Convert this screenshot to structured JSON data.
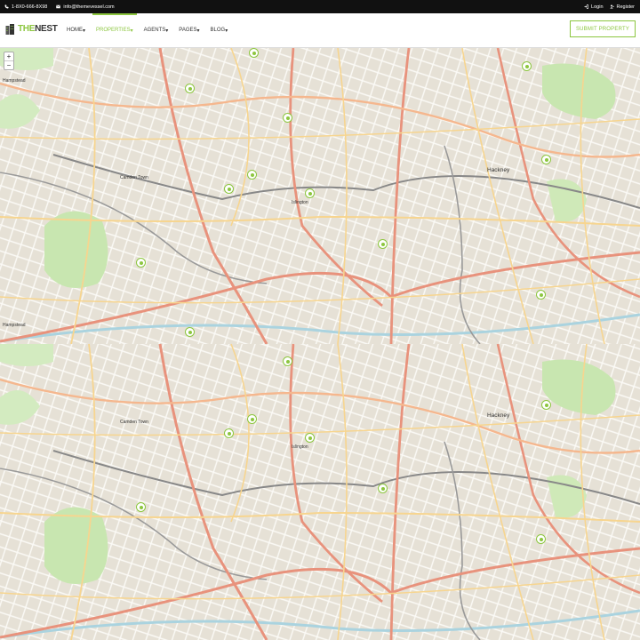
{
  "topbar": {
    "phone": "1-8X0-666-8X98",
    "email": "info@themevessel.com",
    "login": "Login",
    "register": "Register"
  },
  "brand": {
    "part1": "THE",
    "part2": "NEST"
  },
  "menu": [
    {
      "label": "HOME",
      "active": false
    },
    {
      "label": "PROPERTIES",
      "active": true
    },
    {
      "label": "AGENTS",
      "active": false
    },
    {
      "label": "PAGES",
      "active": false
    },
    {
      "label": "BLOG",
      "active": false
    }
  ],
  "submit_label": "SUBMIT PROPERTY",
  "zoom": {
    "in": "+",
    "out": "−"
  },
  "map_labels": {
    "hampstead": "Hampstead",
    "camden": "Camden Town",
    "islington": "Islington",
    "hackney": "Hackney",
    "hampstead2": "Hampstead",
    "camden2": "Camden Town",
    "islington2": "Islington",
    "hackney2": "Hackney"
  },
  "colors": {
    "accent": "#8cc63f",
    "topbar_bg": "#111111",
    "map_bg": "#e9e5dc",
    "road_major": "#e8927c",
    "road_minor": "#f7d58f",
    "park": "#c8e6b0"
  }
}
